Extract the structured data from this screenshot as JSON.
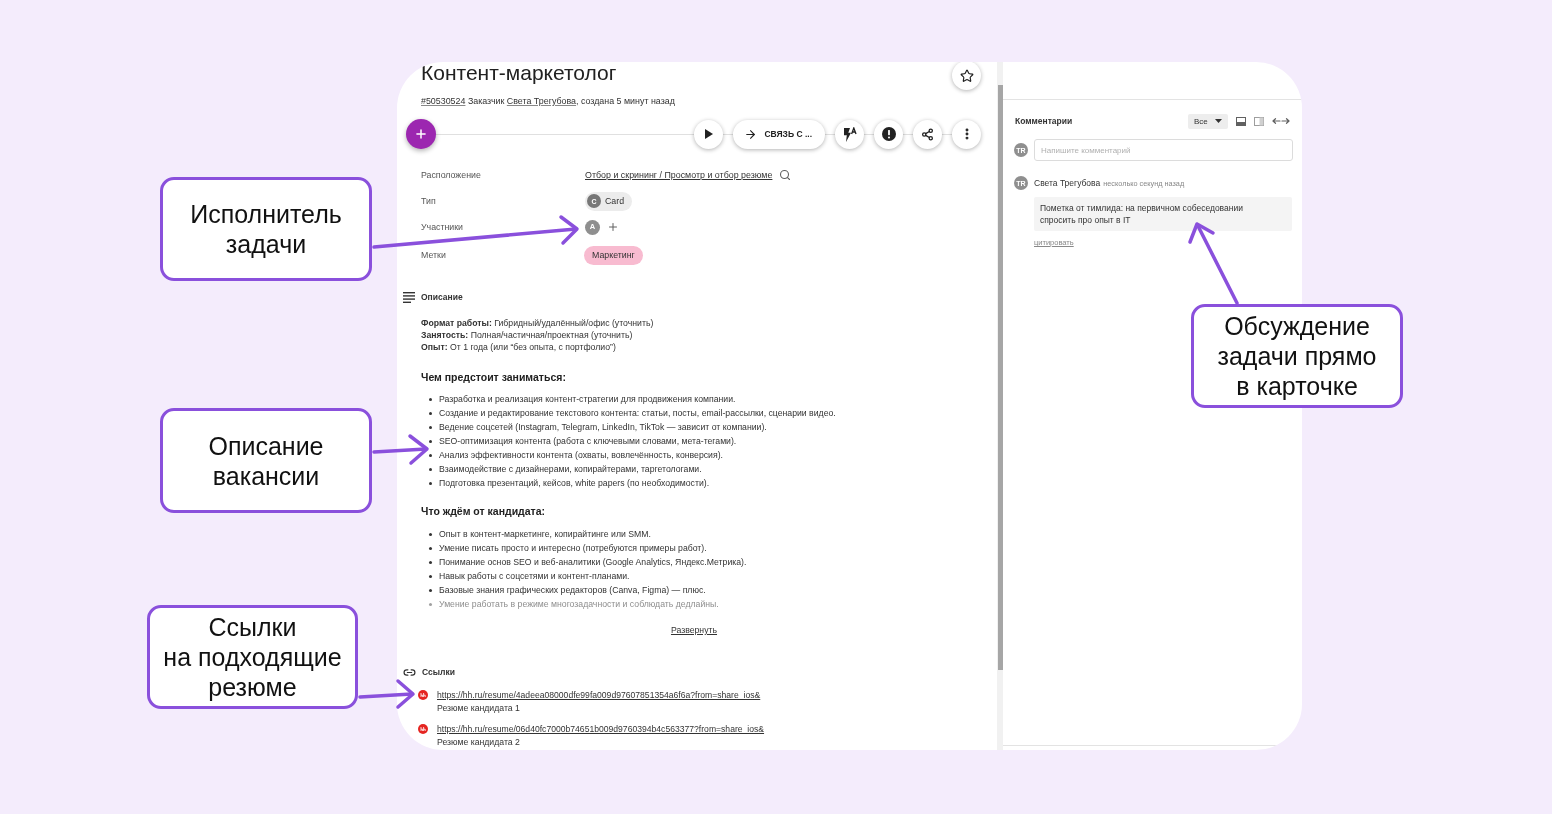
{
  "task": {
    "title": "Контент-маркетолог",
    "meta": {
      "id": "#50530524",
      "customer_label": "Заказчик",
      "customer": "Света Трегубова",
      "created": ", создана 5 минут назад"
    },
    "action": "СВЯЗЬ С ..."
  },
  "properties": [
    {
      "kind": "link",
      "label": "Расположение",
      "value": "Отбор и скрининг / Просмотр и отбор резюме"
    },
    {
      "kind": "chip",
      "label": "Тип",
      "avatar": "C",
      "value": "Card"
    },
    {
      "kind": "members",
      "label": "Участники",
      "avatar": "A"
    },
    {
      "kind": "tag",
      "label": "Метки",
      "value": "Маркетинг"
    }
  ],
  "description": {
    "title": "Описание",
    "collapsed": true,
    "facts": [
      "**Формат работы:** Гибридный/удалённый/офис (уточнить)",
      "**Занятость:** Полная/частичная/проектная (уточнить)",
      "**Опыт:** От 1 года (или “без опыта, с портфолио”)"
    ],
    "sections": [
      {
        "heading": "Чем предстоит заниматься:",
        "items": [
          "Разработка и реализация контент-стратегии для продвижения компании.",
          "Создание и редактирование текстового контента: статьи, посты, email-рассылки, сценарии видео.",
          "Ведение соцсетей (Instagram, Telegram, LinkedIn, TikTok — зависит от компании).",
          "SEO-оптимизация контента (работа с ключевыми словами, мета-тегами).",
          "Анализ эффективности контента (охваты, вовлечённость, конверсия).",
          "Взаимодействие с дизайнерами, копирайтерами, таргетологами.",
          "Подготовка презентаций, кейсов, white papers (по необходимости)."
        ]
      },
      {
        "heading": "Что ждём от кандидата:",
        "items": [
          "Опыт в контент-маркетинге, копирайтинге или SMM.",
          "Умение писать просто и интересно (потребуются примеры работ).",
          "Понимание основ SEO и веб-аналитики (Google Analytics, Яндекс.Метрика).",
          "Навык работы с соцсетями и контент-планами.",
          "Базовые знания графических редакторов (Canva, Figma) — плюс.",
          "Умение работать в режиме многозадачности и соблюдать дедлайны."
        ]
      }
    ],
    "expand": "Развернуть"
  },
  "links": {
    "title": "Ссылки",
    "items": [
      {
        "url": "https://hh.ru/resume/4adeea08000dfe99fa009d97607851354a6f6a?from=share_ios&",
        "caption": "Резюме кандидата 1"
      },
      {
        "url": "https://hh.ru/resume/06d40fc7000b74651b009d9760394b4c563377?from=share_ios&",
        "caption": "Резюме кандидата 2"
      }
    ]
  },
  "comments": {
    "title": "Комментарии",
    "filter": "Все",
    "input": {
      "avatar": "TR",
      "placeholder": "Напишите комментарий"
    },
    "items": [
      {
        "avatar": "TR",
        "author": "Света Трегубова",
        "time": "несколько секунд назад",
        "text": "Пометка от тимлида: на первичном собеседовании спросить про опыт в IT",
        "quote": "цитировать"
      }
    ]
  },
  "annotations": [
    {
      "lines": [
        "Исполнитель",
        "задачи"
      ]
    },
    {
      "lines": [
        "Описание",
        "вакансии"
      ]
    },
    {
      "lines": [
        "Ссылки",
        "на подходящие",
        "резюме"
      ]
    },
    {
      "lines": [
        "Обсуждение",
        "задачи прямо",
        "в карточке"
      ]
    }
  ]
}
